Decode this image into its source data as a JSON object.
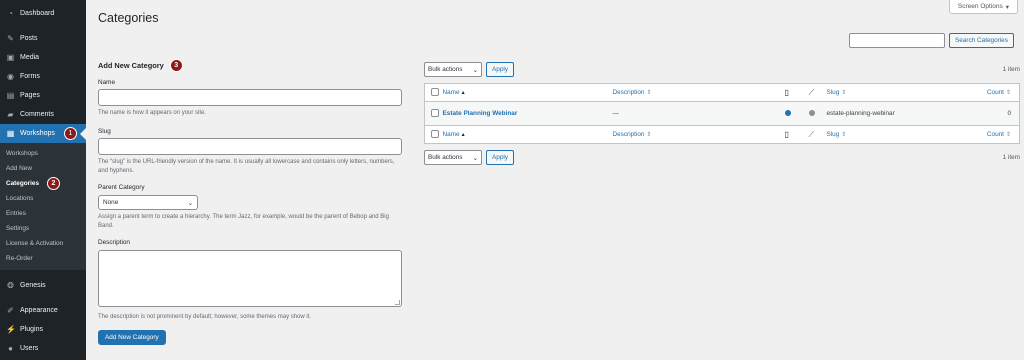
{
  "sidebar": {
    "items_top": [
      {
        "label": "Dashboard",
        "icon": "dashboard-icon"
      },
      {
        "label": "Posts",
        "icon": "pin-icon"
      },
      {
        "label": "Media",
        "icon": "media-icon"
      },
      {
        "label": "Forms",
        "icon": "forms-icon"
      },
      {
        "label": "Pages",
        "icon": "pages-icon"
      },
      {
        "label": "Comments",
        "icon": "comments-icon"
      }
    ],
    "active": {
      "label": "Workshops",
      "icon": "calendar-icon",
      "badge": "1"
    },
    "submenu": [
      {
        "label": "Workshops"
      },
      {
        "label": "Add New"
      },
      {
        "label": "Categories",
        "badge": "2"
      },
      {
        "label": "Locations"
      },
      {
        "label": "Entries"
      },
      {
        "label": "Settings"
      },
      {
        "label": "License & Activation"
      },
      {
        "label": "Re-Order"
      }
    ],
    "items_bottom": [
      {
        "label": "Genesis",
        "icon": "genesis-icon"
      },
      {
        "label": "Appearance",
        "icon": "brush-icon"
      },
      {
        "label": "Plugins",
        "icon": "plugin-icon"
      },
      {
        "label": "Users",
        "icon": "users-icon"
      }
    ]
  },
  "header": {
    "title": "Categories",
    "screen_options": "Screen Options"
  },
  "search": {
    "button": "Search Categories",
    "value": ""
  },
  "form": {
    "heading": "Add New Category",
    "heading_badge": "3",
    "name_label": "Name",
    "name_help": "The name is how it appears on your site.",
    "slug_label": "Slug",
    "slug_help": "The “slug” is the URL-friendly version of the name. It is usually all lowercase and contains only letters, numbers, and hyphens.",
    "parent_label": "Parent Category",
    "parent_value": "None",
    "parent_help": "Assign a parent term to create a hierarchy. The term Jazz, for example, would be the parent of Bebop and Big Band.",
    "description_label": "Description",
    "description_help": "The description is not prominent by default; however, some themes may show it.",
    "submit": "Add New Category"
  },
  "table": {
    "bulk_label": "Bulk actions",
    "apply": "Apply",
    "count": "1 item",
    "columns": {
      "name": "Name",
      "description": "Description",
      "slug": "Slug",
      "count": "Count"
    },
    "rows": [
      {
        "name": "Estate Planning Webinar",
        "description": "—",
        "slug": "estate-planning-webinar",
        "count": "0"
      }
    ]
  },
  "colors": {
    "accent": "#2271b1",
    "sidebar": "#1d2327",
    "badge": "#8c1a1a"
  }
}
